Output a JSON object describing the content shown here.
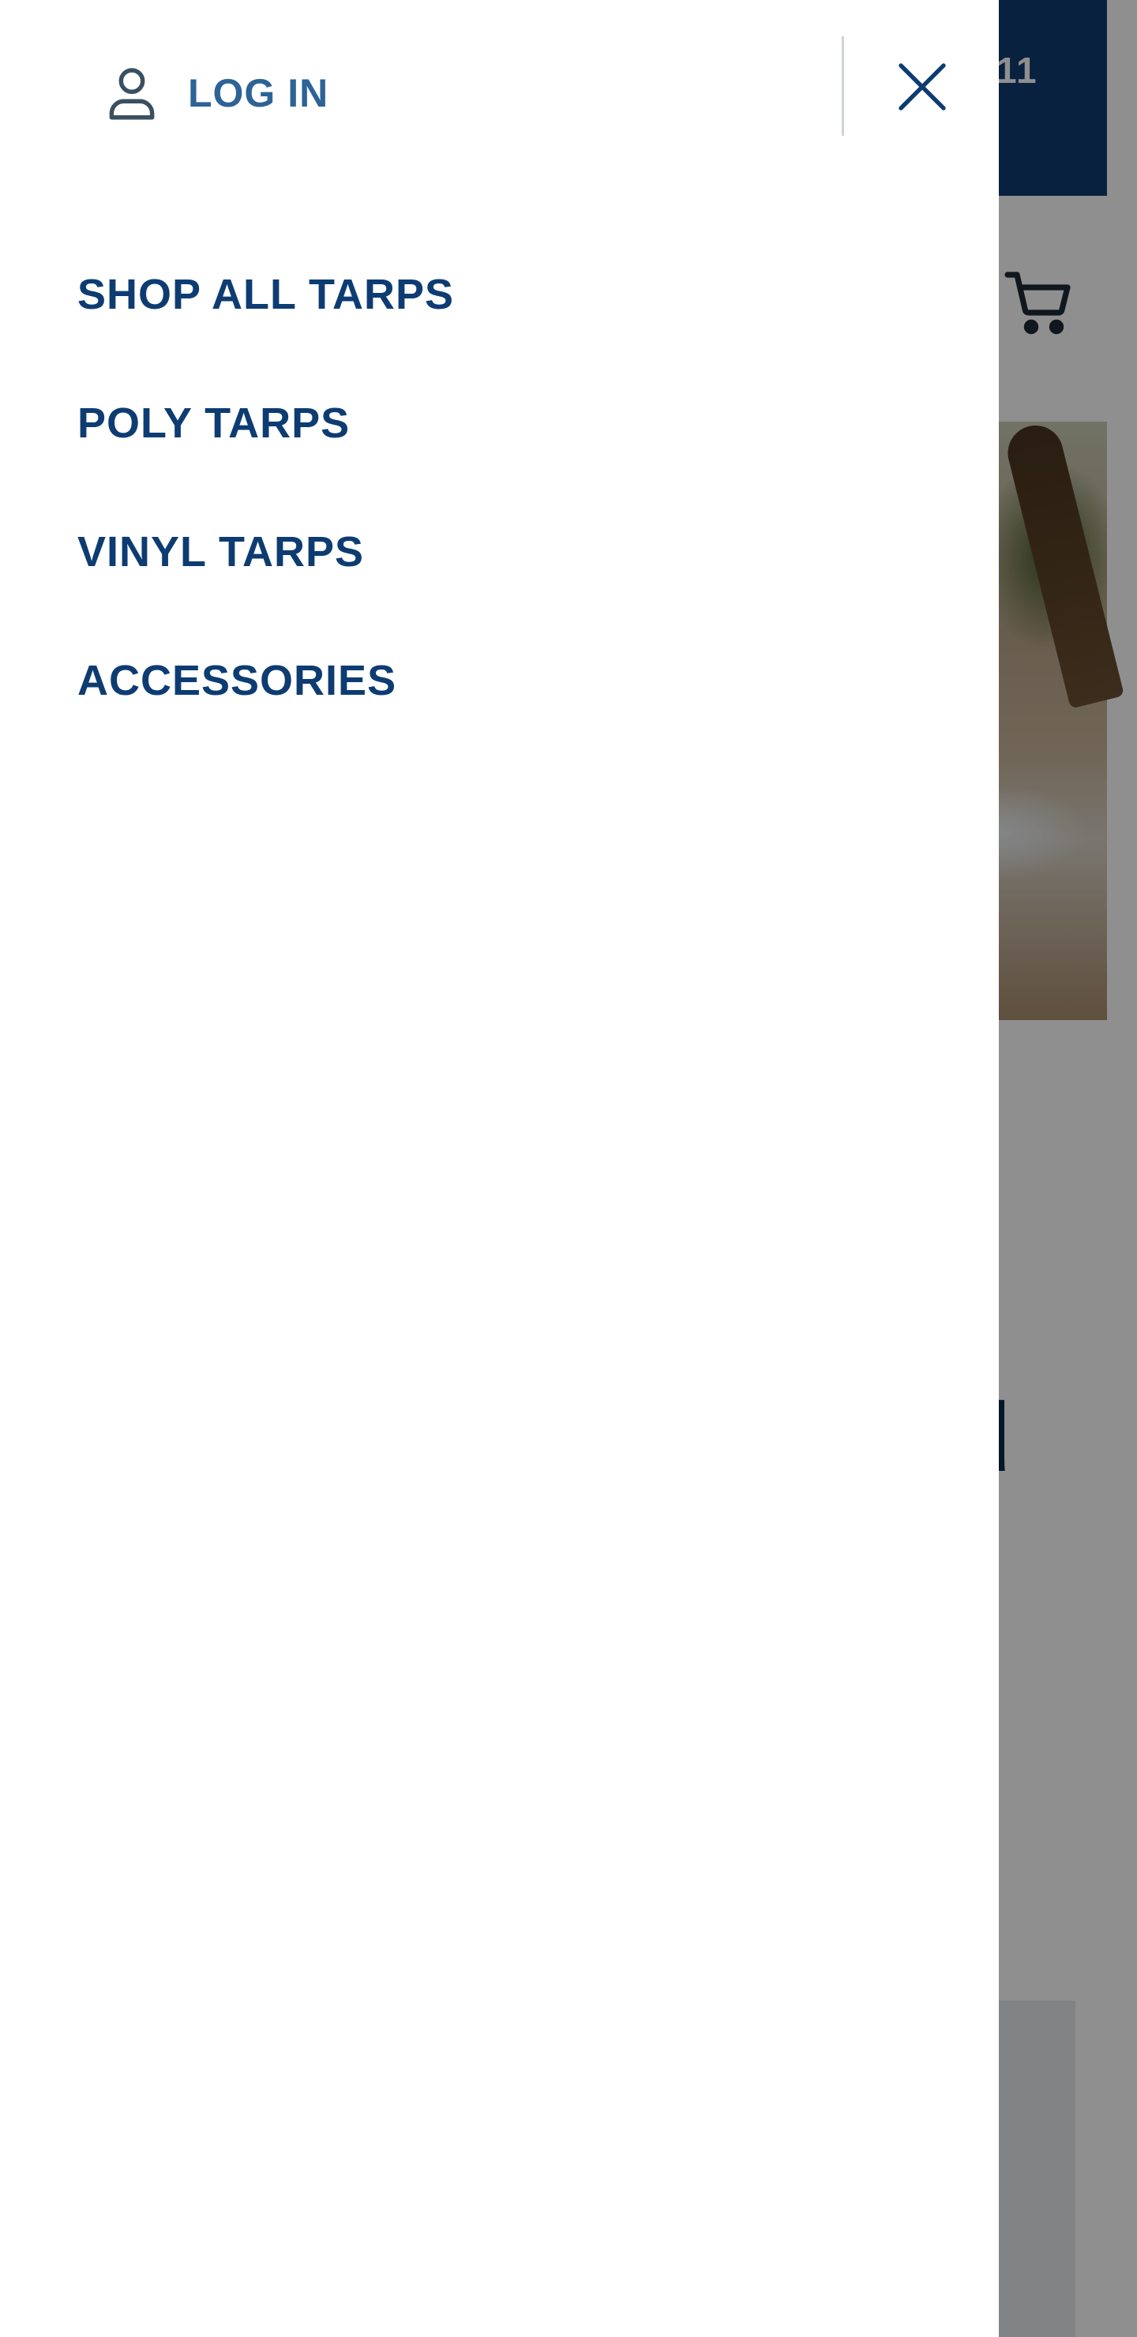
{
  "background": {
    "topbar_text": "11",
    "headline_fragment": "u",
    "topbar_color": "#0f3b70",
    "cart_icon": "shopping-cart-icon"
  },
  "drawer": {
    "login": {
      "icon": "user-icon",
      "label": "LOG IN"
    },
    "close": {
      "icon": "close-icon"
    },
    "nav_items": [
      {
        "label": "SHOP ALL TARPS"
      },
      {
        "label": "POLY TARPS"
      },
      {
        "label": "VINYL TARPS"
      },
      {
        "label": "ACCESSORIES"
      }
    ]
  },
  "colors": {
    "nav_text": "#0d3c72",
    "login_text": "#2d6396",
    "overlay": "rgba(0,0,0,0.44)"
  }
}
